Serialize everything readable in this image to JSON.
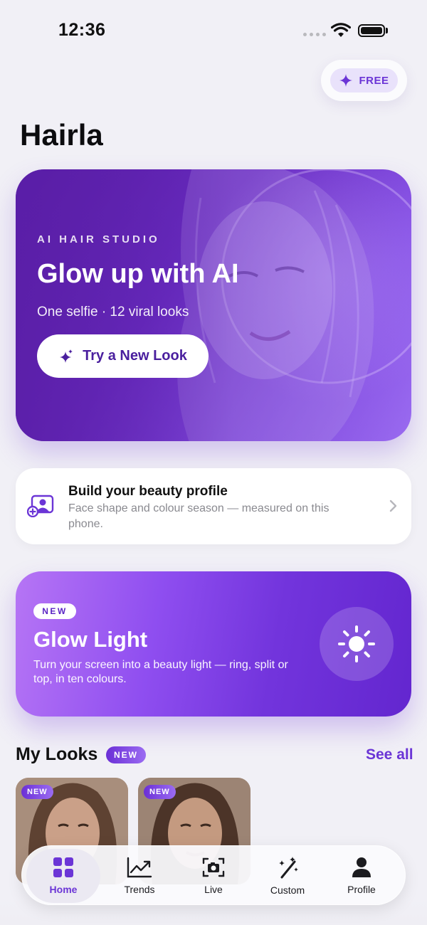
{
  "status_bar": {
    "time": "12:36"
  },
  "header": {
    "free_label": "FREE",
    "app_title": "Hairla"
  },
  "hero": {
    "eyebrow": "AI HAIR STUDIO",
    "title": "Glow up with AI",
    "subtitle": "One selfie · 12 viral looks",
    "cta_label": "Try a New Look"
  },
  "profile_card": {
    "title": "Build your beauty profile",
    "description": "Face shape and colour season — measured on this phone."
  },
  "glow_light": {
    "badge": "NEW",
    "title": "Glow Light",
    "description": "Turn your screen into a beauty light — ring, split or top, in ten colours."
  },
  "my_looks": {
    "title": "My Looks",
    "badge": "NEW",
    "see_all": "See all",
    "items": [
      {
        "badge": "NEW"
      },
      {
        "badge": "NEW"
      }
    ]
  },
  "tab_bar": {
    "tabs": [
      {
        "label": "Home",
        "icon": "grid-icon",
        "active": true
      },
      {
        "label": "Trends",
        "icon": "trend-chart-icon",
        "active": false
      },
      {
        "label": "Live",
        "icon": "camera-icon",
        "active": false
      },
      {
        "label": "Custom",
        "icon": "magic-wand-icon",
        "active": false
      },
      {
        "label": "Profile",
        "icon": "person-icon",
        "active": false
      }
    ]
  },
  "colors": {
    "accent": "#6b35d6",
    "background": "#f1f0f6",
    "hero_start": "#5a1ea7",
    "hero_end": "#9a6bf0"
  }
}
